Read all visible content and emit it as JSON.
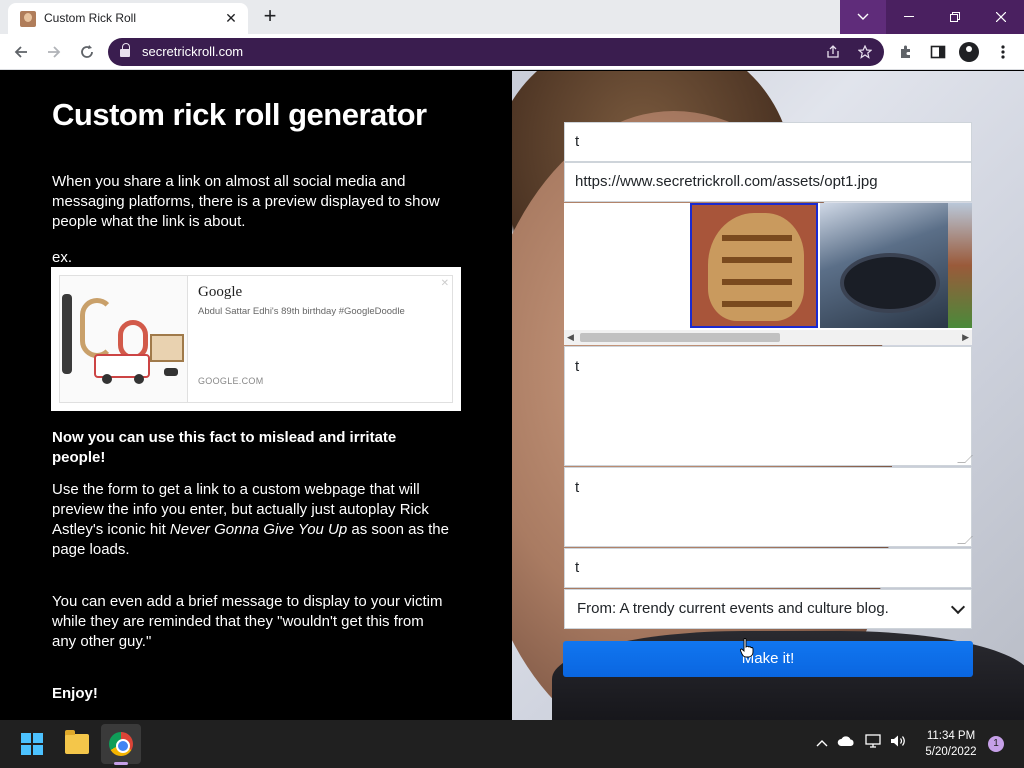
{
  "browser": {
    "tab_title": "Custom Rick Roll",
    "tab_close": "✕",
    "new_tab": "+",
    "url": "secretrickroll.com"
  },
  "left": {
    "title": "Custom rick roll generator",
    "intro": "When you share a link on almost all social media and messaging platforms, there is a preview displayed to show people what the link is about.",
    "ex_label": "ex.",
    "preview": {
      "title": "Google",
      "description": "Abdul Sattar Edhi's 89th birthday #GoogleDoodle",
      "domain": "GOOGLE.COM",
      "close": "✕"
    },
    "mislead": "Now you can use this fact to mislead and irritate people!",
    "use_form_1": "Use the form to get a link to a custom webpage that will preview the info you enter, but actually just autoplay Rick Astley's iconic hit ",
    "use_form_song": "Never Gonna Give You Up",
    "use_form_2": " as soon as the page loads.",
    "brief_msg": "You can even add a brief message to display to your victim while they are reminded that they \"wouldn't get this from any other guy.\"",
    "enjoy": "Enjoy!"
  },
  "form": {
    "title_value": "t",
    "image_url_value": "https://www.secretrickroll.com/assets/opt1.jpg",
    "description_value": "t",
    "message_value": "t",
    "site_name_value": "t",
    "from_selected": "From: A trendy current events and culture blog.",
    "submit_label": "Make it!"
  },
  "taskbar": {
    "time": "11:34 PM",
    "date": "5/20/2022",
    "notification_count": "1"
  }
}
